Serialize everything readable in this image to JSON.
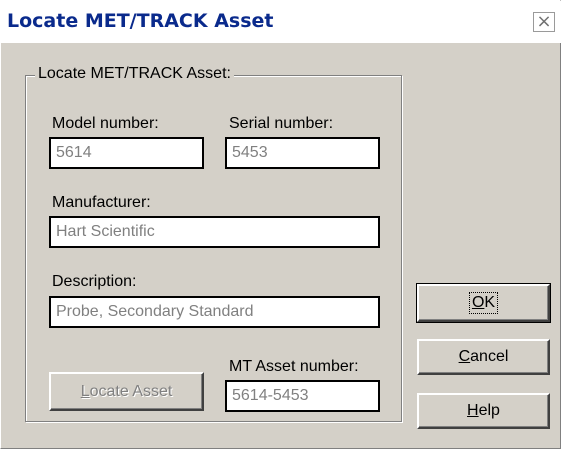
{
  "window": {
    "title": "Locate MET/TRACK Asset",
    "close_glyph": "×"
  },
  "group": {
    "label": "Locate MET/TRACK Asset:"
  },
  "fields": {
    "model_number": {
      "label": "Model number:",
      "value": "5614"
    },
    "serial_number": {
      "label": "Serial number:",
      "value": "5453"
    },
    "manufacturer": {
      "label": "Manufacturer:",
      "value": "Hart Scientific"
    },
    "description": {
      "label": "Description:",
      "value": "Probe, Secondary Standard"
    },
    "mt_asset_number": {
      "label": "MT Asset number:",
      "value": "5614-5453"
    }
  },
  "buttons": {
    "locate_asset": {
      "mnemonic": "L",
      "rest": "ocate Asset",
      "enabled": false
    },
    "ok": {
      "mnemonic": "O",
      "rest": "K"
    },
    "cancel": {
      "mnemonic": "C",
      "rest": "ancel"
    },
    "help": {
      "mnemonic": "H",
      "rest": "elp"
    }
  },
  "colors": {
    "title_text": "#0a2a8c",
    "dialog_face": "#d4d0c8",
    "disabled_text": "#808080"
  }
}
